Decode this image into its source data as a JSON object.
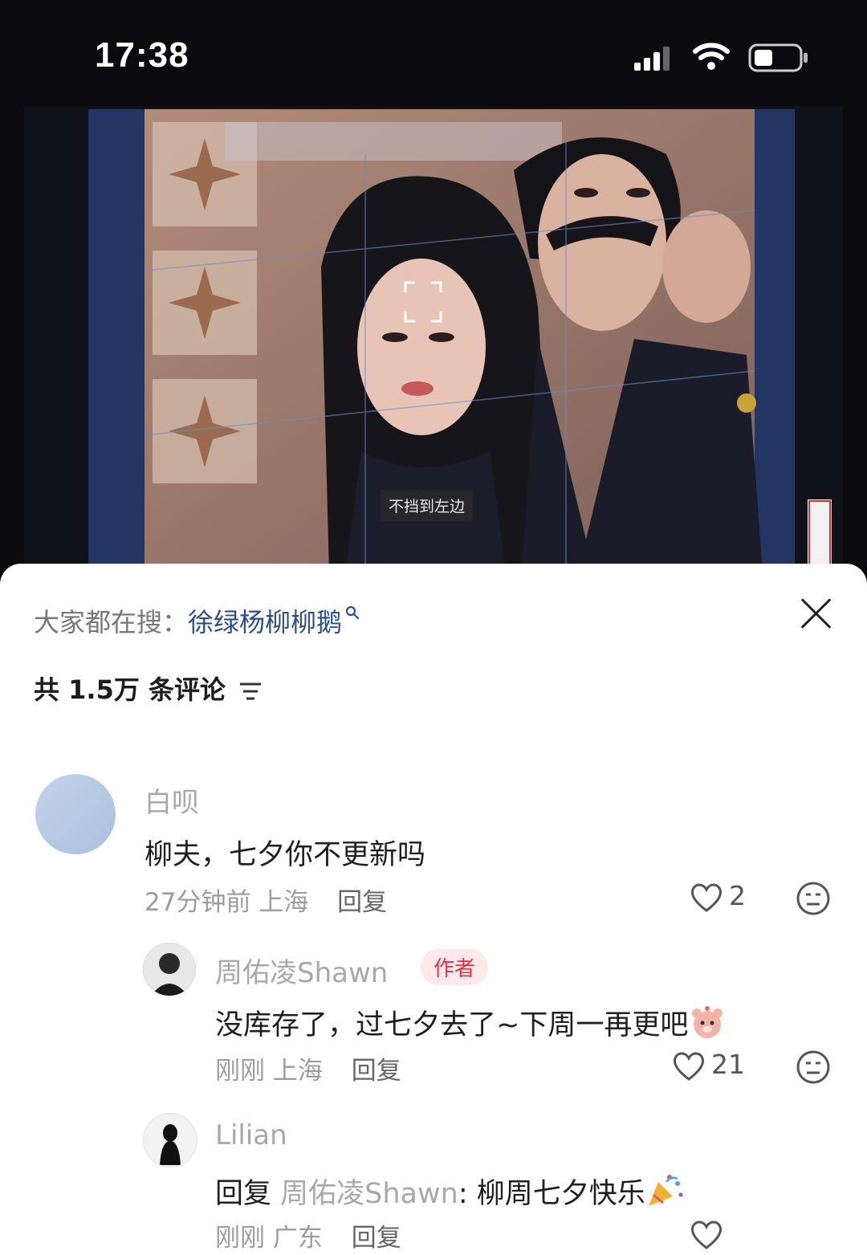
{
  "status_bar": {
    "time": "17:38"
  },
  "video": {
    "subtitle": "不挡到左边"
  },
  "sheet": {
    "trending_prefix": "大家都在搜：",
    "trending_term": "徐绿杨柳柳鹅",
    "comment_count": "共 1.5万 条评论"
  },
  "comments": [
    {
      "user": "白呗",
      "text": "柳夫，七夕你不更新吗",
      "time": "27分钟前",
      "location": "上海",
      "reply_label": "回复",
      "likes": "2"
    },
    {
      "user": "周佑凌Shawn",
      "badge": "作者",
      "text": "没库存了，过七夕去了~下周一再更吧",
      "time": "刚刚",
      "location": "上海",
      "reply_label": "回复",
      "likes": "21"
    },
    {
      "user": "Lilian",
      "text_prefix": "回复",
      "reply_to": "周佑凌Shawn",
      "text": ": 柳周七夕快乐",
      "time": "刚刚",
      "location": "广东",
      "reply_label": "回复"
    }
  ],
  "colors": {
    "accent_link": "#2a4e86",
    "author_badge": "#e8314c"
  },
  "icons": [
    "signal-icon",
    "wifi-icon",
    "battery-icon",
    "close-icon",
    "sort-icon",
    "heart-icon",
    "dislike-face-icon",
    "search-icon",
    "party-popper-icon",
    "bear-emoji-icon"
  ]
}
